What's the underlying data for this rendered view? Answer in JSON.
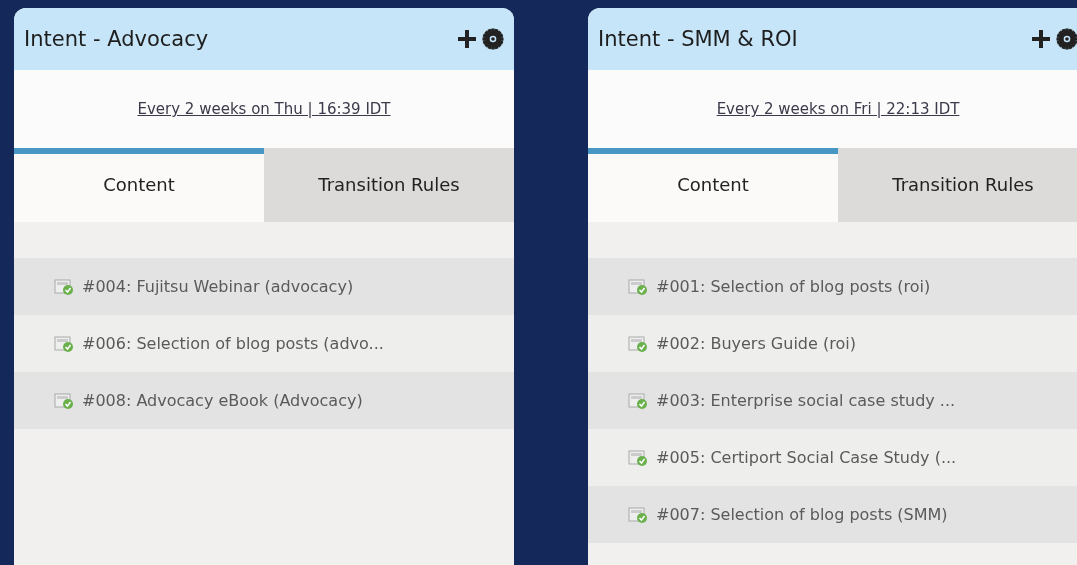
{
  "panels": [
    {
      "title": "Intent - Advocacy",
      "schedule": "Every 2 weeks on Thu | 16:39 IDT",
      "tabs": [
        {
          "label": "Content",
          "selected": true
        },
        {
          "label": "Transition Rules",
          "selected": false
        }
      ],
      "items": [
        {
          "label": "#004: Fujitsu Webinar (advocacy)"
        },
        {
          "label": "#006: Selection of blog posts (advo..."
        },
        {
          "label": "#008: Advocacy eBook (Advocacy)"
        }
      ]
    },
    {
      "title": "Intent - SMM & ROI",
      "schedule": "Every 2 weeks on Fri | 22:13 IDT",
      "tabs": [
        {
          "label": "Content",
          "selected": true
        },
        {
          "label": "Transition Rules",
          "selected": false
        }
      ],
      "items": [
        {
          "label": "#001: Selection of blog posts (roi)"
        },
        {
          "label": "#002: Buyers Guide (roi)"
        },
        {
          "label": "#003: Enterprise social case study ..."
        },
        {
          "label": "#005: Certiport Social Case Study (..."
        },
        {
          "label": "#007: Selection of blog posts (SMM)"
        }
      ]
    }
  ]
}
